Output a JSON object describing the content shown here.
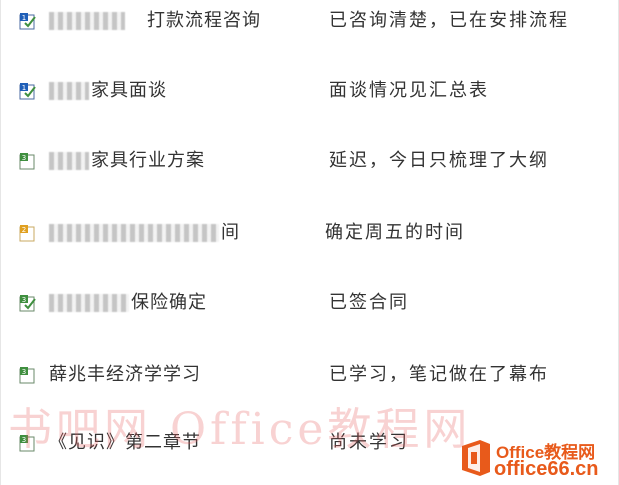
{
  "tasks": [
    {
      "icon": "checkbox-1-icon",
      "task": "打款流程咨询",
      "result": "已咨询清楚，已在安排流程",
      "blur_width": 76
    },
    {
      "icon": "checkbox-1-icon",
      "task": "家具面谈",
      "result": "面谈情况见汇总表",
      "blur_width": 40
    },
    {
      "icon": "checkbox-3-icon",
      "task": "家具行业方案",
      "result": "延迟，今日只梳理了大纲",
      "blur_width": 40
    },
    {
      "icon": "checkbox-2-icon",
      "task": "间",
      "result": "确定周五的时间",
      "blur_width": 130
    },
    {
      "icon": "checkbox-3-icon",
      "task": "保险确定",
      "result": "已签合同",
      "blur_width": 80
    },
    {
      "icon": "checkbox-3-icon",
      "task": "薛兆丰经济学学习",
      "result": "已学习，笔记做在了幕布",
      "blur_width": 0
    },
    {
      "icon": "checkbox-3-icon",
      "task": "《见识》第二章节",
      "result": "尚未学习",
      "blur_width": 0
    }
  ],
  "watermark": "书吧网 Office教程网",
  "logo": {
    "line1": "Office教程网",
    "line2": "office66.cn"
  },
  "colors": {
    "icon_blue": "#1f5fb8",
    "icon_green": "#3f8f3f",
    "icon_orange": "#e0a020",
    "text": "#333333",
    "brand": "#e85a1b"
  }
}
